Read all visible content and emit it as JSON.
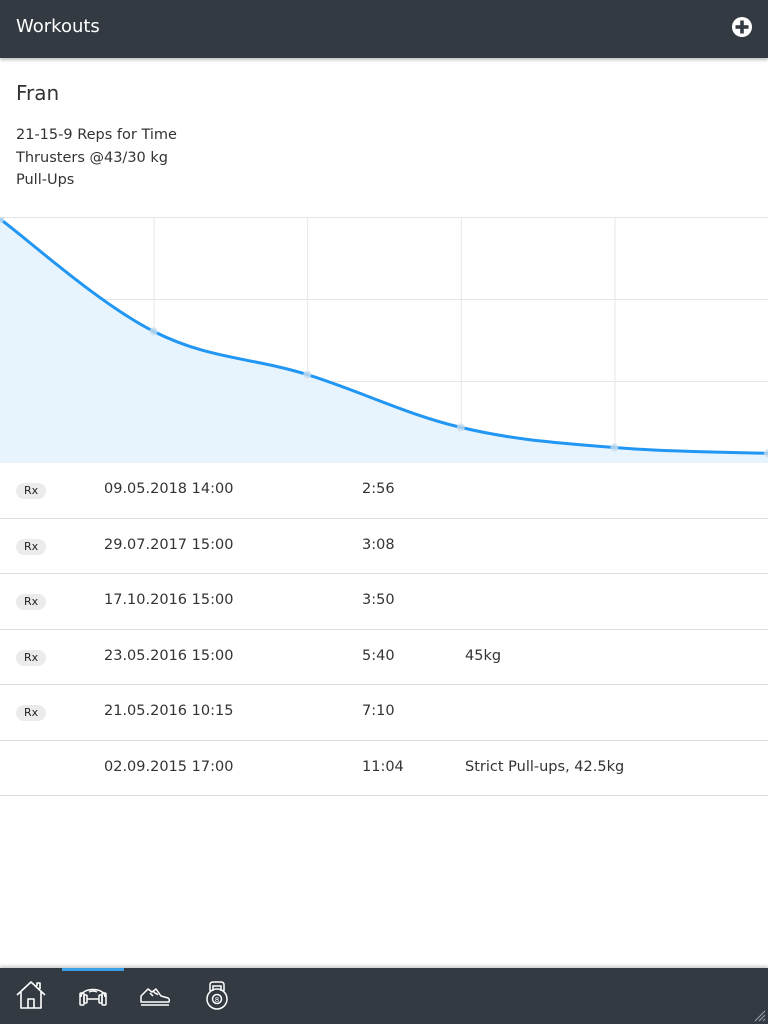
{
  "header": {
    "title": "Workouts",
    "add_icon": "plus-circle-icon"
  },
  "workout": {
    "name": "Fran",
    "description_lines": [
      "21-15-9 Reps for Time",
      "Thrusters @43/30 kg",
      "Pull-Ups"
    ]
  },
  "chart_data": {
    "type": "area",
    "x": [
      "02.09.2015",
      "21.05.2016",
      "23.05.2016",
      "17.10.2016",
      "29.07.2017",
      "09.05.2018"
    ],
    "series": [
      {
        "values_seconds": [
          664,
          430,
          340,
          230,
          188,
          176
        ]
      }
    ],
    "ylim": [
      160,
      664
    ],
    "grid": true,
    "colors": {
      "line": "#2196f3",
      "fill": "#e5f3fd",
      "grid": "#e6e6e6",
      "point": "#c7dcec"
    }
  },
  "results": [
    {
      "rx": "Rx",
      "date": "09.05.2018 14:00",
      "time": "2:56",
      "note": ""
    },
    {
      "rx": "Rx",
      "date": "29.07.2017 15:00",
      "time": "3:08",
      "note": ""
    },
    {
      "rx": "Rx",
      "date": "17.10.2016 15:00",
      "time": "3:50",
      "note": ""
    },
    {
      "rx": "Rx",
      "date": "23.05.2016 15:00",
      "time": "5:40",
      "note": "45kg"
    },
    {
      "rx": "Rx",
      "date": "21.05.2016 10:15",
      "time": "7:10",
      "note": ""
    },
    {
      "rx": "",
      "date": "02.09.2015 17:00",
      "time": "11:04",
      "note": "Strict Pull-ups, 42.5kg"
    }
  ],
  "nav": {
    "tabs": [
      {
        "icon": "home-icon",
        "active": false
      },
      {
        "icon": "dumbbell-icon",
        "active": true
      },
      {
        "icon": "running-shoe-icon",
        "active": false
      },
      {
        "icon": "kettlebell-icon",
        "active": false
      }
    ],
    "active_color": "#3aa0e8"
  }
}
